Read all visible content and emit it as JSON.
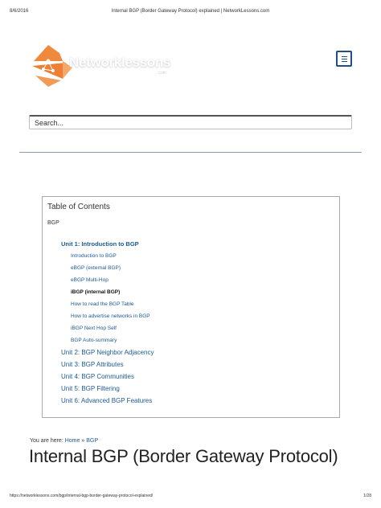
{
  "print_header": {
    "date": "8/6/2016",
    "title": "Internal BGP (Border Gateway Protocol) explained | NetworkLessons.com"
  },
  "logo": {
    "text": "Networklessons",
    "subtext": ".com",
    "accent_color": "#f0883e"
  },
  "menu": {
    "icon": "hamburger-menu-icon",
    "color": "#1f4f84"
  },
  "search": {
    "placeholder": "Search..."
  },
  "toc": {
    "title": "Table of Contents",
    "root": "BGP",
    "units": [
      {
        "label": "Unit 1: Introduction to BGP",
        "lessons": [
          "Introduction to BGP",
          "eBGP (external BGP)",
          "eBGP Multi-Hop",
          "iBGP (internal BGP)",
          "How to read the BGP Table",
          "How to advertise networks in BGP",
          "iBGP Next Hop Self",
          "BGP Auto-summary"
        ]
      },
      {
        "label": "Unit 2: BGP Neighbor Adjacency"
      },
      {
        "label": "Unit 3: BGP Attributes"
      },
      {
        "label": "Unit 4: BGP Communities"
      },
      {
        "label": "Unit 5: BGP Filtering"
      },
      {
        "label": "Unit 6: Advanced BGP Features"
      }
    ],
    "link_color": "#1a5a96"
  },
  "breadcrumb": {
    "prefix": "You are here:",
    "home": "Home",
    "separator": "»",
    "current": "BGP"
  },
  "page_title": "Internal BGP (Border Gateway Protocol)",
  "print_footer": {
    "url": "https://networklessons.com/bgp/internal-bgp-border-gateway-protocol-explained/",
    "page": "1/28"
  }
}
